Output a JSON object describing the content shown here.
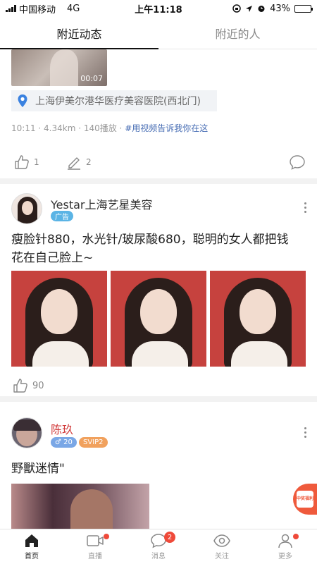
{
  "status_bar": {
    "carrier": "中国移动",
    "network": "4G",
    "time": "上午11:18",
    "battery_percent": "43%",
    "battery_level": 0.43
  },
  "tabs": [
    {
      "label": "附近动态",
      "active": true
    },
    {
      "label": "附近的人",
      "active": false
    }
  ],
  "post1": {
    "video_duration": "00:07",
    "location": "上海伊美尔港华医疗美容医院(西北门)",
    "meta": "10:11 · 4.34km · 140播放 · ",
    "hashtag": "#用视频告诉我你在这",
    "likes": "1",
    "comments": "2"
  },
  "post2": {
    "username": "Yestar上海艺星美容",
    "ad_badge": "广告",
    "text_line1": "瘦脸针880，水光针/玻尿酸680，聪明的女人都把钱",
    "text_line2": "花在自己脸上~",
    "likes": "90"
  },
  "post3": {
    "username": "陈玖",
    "gender_age_badge": "♂ 20",
    "vip_badge": "SVIP2",
    "text": "野獸迷情\""
  },
  "float_button": {
    "label": "中奖福利"
  },
  "bottom_nav": [
    {
      "label": "首页",
      "icon": "home-icon",
      "active": true
    },
    {
      "label": "直播",
      "icon": "live-camera-icon"
    },
    {
      "label": "消息",
      "icon": "message-bubble-icon",
      "badge": "2"
    },
    {
      "label": "关注",
      "icon": "eye-icon"
    },
    {
      "label": "更多",
      "icon": "person-icon"
    }
  ],
  "colors": {
    "accent_red": "#ef4a3a",
    "link_blue": "#4a6fb5",
    "ad_badge": "#5bb4e5",
    "gender_badge": "#7aa7e6",
    "vip_badge": "#f1a15d",
    "username_red": "#d03a3a"
  }
}
